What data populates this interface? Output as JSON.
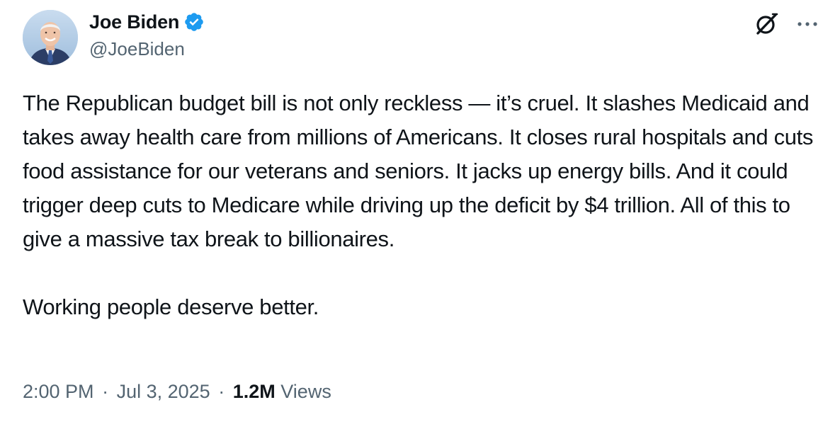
{
  "author": {
    "display_name": "Joe Biden",
    "handle": "@JoeBiden",
    "verified": true,
    "verified_color": "#1d9bf0"
  },
  "tweet": {
    "paragraphs": [
      "The Republican budget bill is not only reckless — it’s cruel. It slashes Medicaid and takes away health care from millions of Americans. It closes rural hospitals and cuts food assistance for our veterans and seniors. It jacks up energy bills. And it could trigger deep cuts to Medicare while driving up the deficit by $4 trillion. All of this to give a massive tax break to billionaires.",
      "Working people deserve better."
    ]
  },
  "meta": {
    "time": "2:00 PM",
    "separator": "·",
    "date": "Jul 3, 2025",
    "views_count": "1.2M",
    "views_label": "Views"
  },
  "icons": {
    "verified": "verified-badge-icon",
    "grok": "grok-icon",
    "more": "more-options-icon"
  },
  "colors": {
    "text_primary": "#0f1419",
    "text_secondary": "#536471",
    "background": "#ffffff"
  }
}
